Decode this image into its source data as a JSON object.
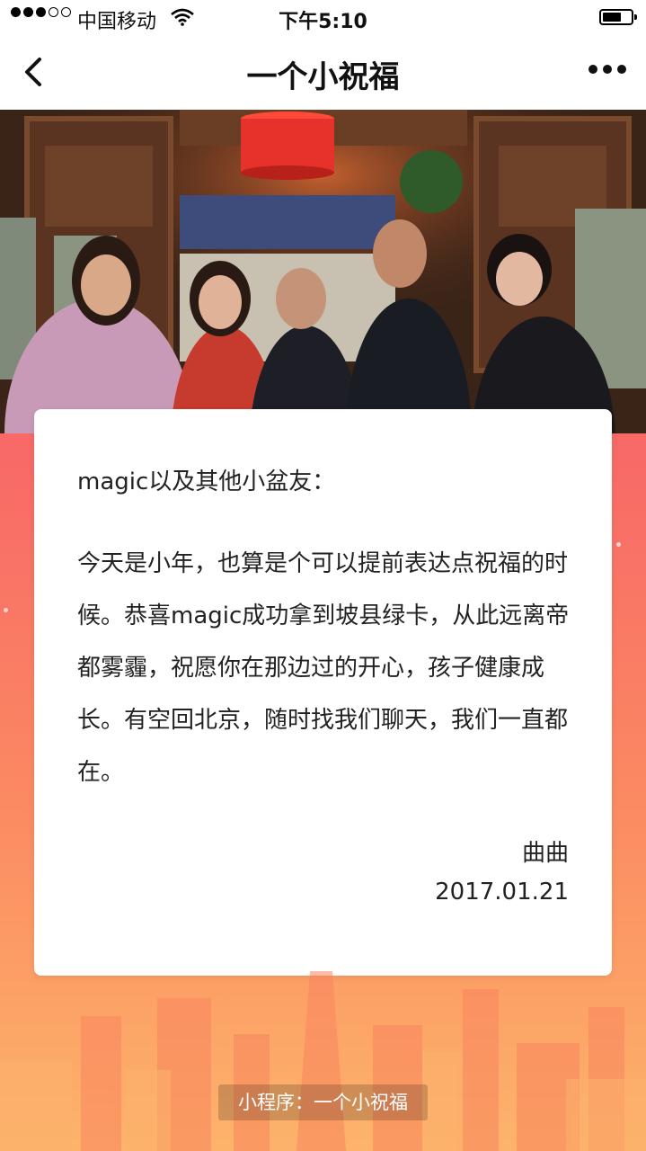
{
  "status_bar": {
    "carrier": "中国移动",
    "time": "下午5:10"
  },
  "nav": {
    "title": "一个小祝福"
  },
  "card": {
    "greeting": "magic以及其他小盆友：",
    "message": "今天是小年，也算是个可以提前表达点祝福的时候。恭喜magic成功拿到坡县绿卡，从此远离帝都雾霾，祝愿你在那边过的开心，孩子健康成长。有空回北京，随时找我们聊天，我们一直都在。",
    "signature": "曲曲",
    "date": "2017.01.21"
  },
  "footer": {
    "label": "小程序：一个小祝福"
  },
  "icons": {
    "back": "chevron-left-icon",
    "more": "more-dots-icon",
    "wifi": "wifi-icon",
    "battery": "battery-icon"
  },
  "colors": {
    "gradient_top": "#f55a6a",
    "gradient_bottom": "#fdb46a",
    "card_bg": "#ffffff",
    "nav_bg": "#ffffff"
  }
}
